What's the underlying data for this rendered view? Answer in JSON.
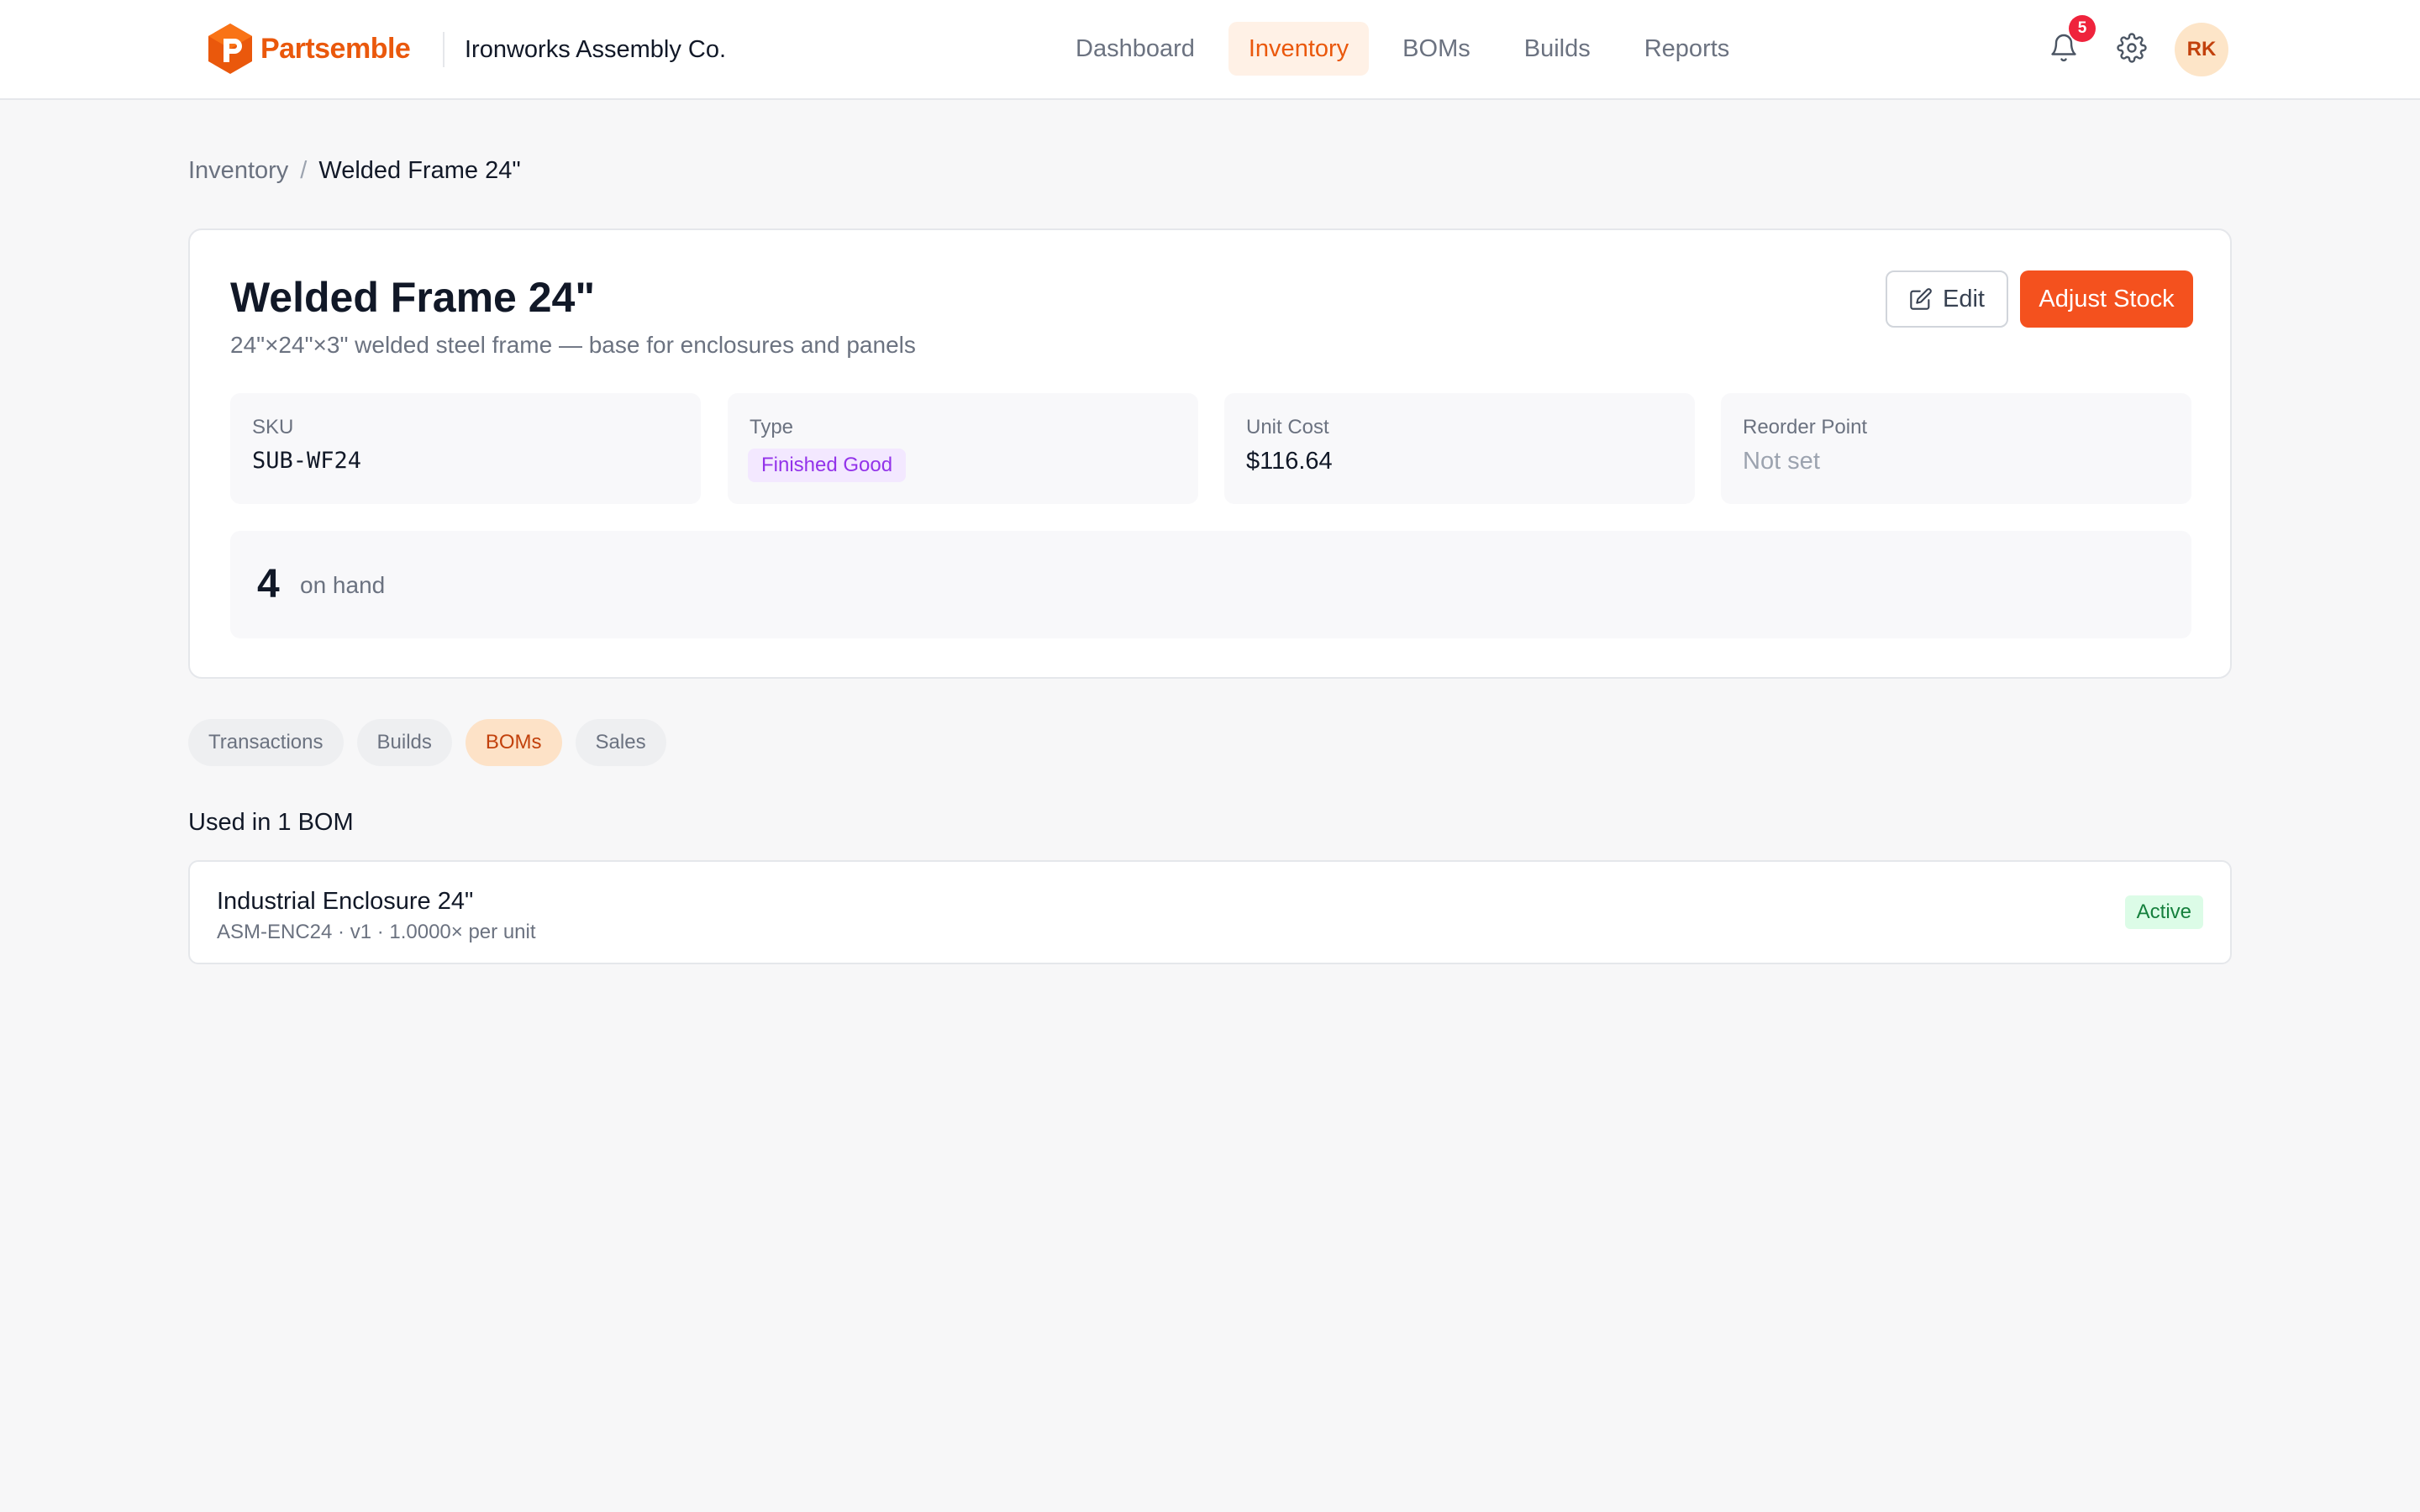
{
  "header": {
    "brand": "Partsemble",
    "company": "Ironworks Assembly Co.",
    "nav": [
      {
        "label": "Dashboard"
      },
      {
        "label": "Inventory"
      },
      {
        "label": "BOMs"
      },
      {
        "label": "Builds"
      },
      {
        "label": "Reports"
      }
    ],
    "active_nav": "Inventory",
    "notification_count": "5",
    "user_initials": "RK",
    "icons": [
      "bell-icon",
      "gear-icon"
    ]
  },
  "breadcrumb": {
    "parent": "Inventory",
    "separator": "/",
    "current": "Welded Frame 24\""
  },
  "item": {
    "title": "Welded Frame 24\"",
    "description": "24\"×24\"×3\" welded steel frame — base for enclosures and panels",
    "edit_label": "Edit",
    "adjust_label": "Adjust Stock",
    "sku_label": "SKU",
    "sku": "SUB-WF24",
    "type_label": "Type",
    "type": "Finished Good",
    "cost_label": "Unit Cost",
    "cost": "$116.64",
    "reorder_label": "Reorder Point",
    "reorder": "Not set",
    "on_hand": "4",
    "on_hand_label": "on hand"
  },
  "tabs": [
    {
      "label": "Transactions"
    },
    {
      "label": "Builds"
    },
    {
      "label": "BOMs"
    },
    {
      "label": "Sales"
    }
  ],
  "active_tab": "BOMs",
  "boms": {
    "title": "Used in 1 BOM",
    "items": [
      {
        "name": "Industrial Enclosure 24\"",
        "meta": "ASM-ENC24 · v1 · 1.0000× per unit",
        "status": "Active"
      }
    ]
  },
  "colors": {
    "accent": "#ea580c",
    "primary_button": "#f4511e",
    "type_pill": "#9333ea",
    "status_active": "#15803d"
  }
}
